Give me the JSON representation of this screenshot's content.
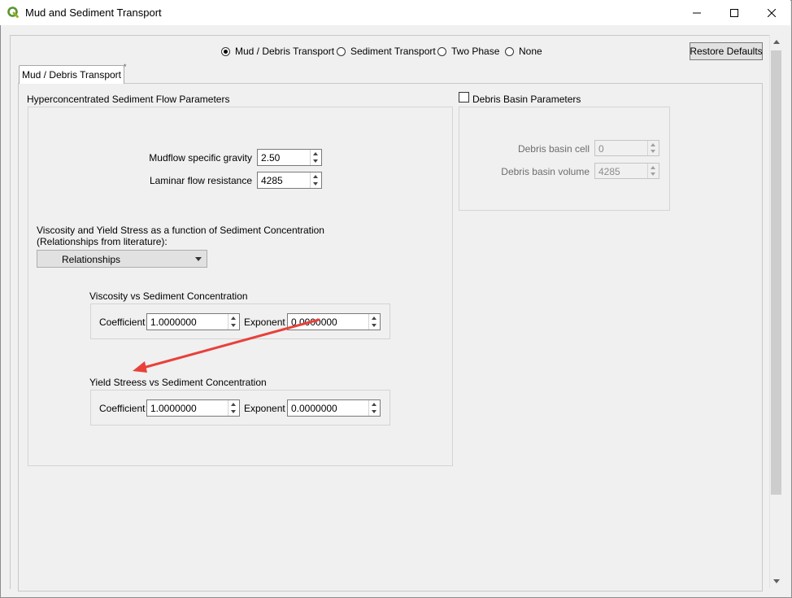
{
  "window": {
    "title": "Mud and Sediment Transport"
  },
  "transport_mode": {
    "options": [
      {
        "label": "Mud / Debris Transport",
        "selected": true
      },
      {
        "label": "Sediment Transport",
        "selected": false
      },
      {
        "label": "Two Phase",
        "selected": false
      },
      {
        "label": "None",
        "selected": false
      }
    ]
  },
  "restore_defaults_label": "Restore Defaults",
  "tab": {
    "label": "Mud / Debris Transport",
    "modified_marker": "*"
  },
  "hyper": {
    "title": "Hyperconcentrated Sediment Flow Parameters",
    "specific_gravity": {
      "label": "Mudflow specific gravity",
      "value": "2.50"
    },
    "laminar_resistance": {
      "label": "Laminar flow resistance",
      "value": "4285"
    },
    "relationships_text_1": "Viscosity and Yield Stress as a function of Sediment Concentration",
    "relationships_text_2": "(Relationships from literature):",
    "relationships_combo": "Relationships",
    "viscosity": {
      "title": "Viscosity vs Sediment Concentration",
      "coefficient_label": "Coefficient",
      "coefficient": "1.0000000",
      "exponent_label": "Exponent",
      "exponent": "0.0000000"
    },
    "yield": {
      "title": "Yield Streess vs Sediment Concentration",
      "coefficient_label": "Coefficient",
      "coefficient": "1.0000000",
      "exponent_label": "Exponent",
      "exponent": "0.0000000"
    }
  },
  "debris": {
    "title": "Debris Basin Parameters",
    "checked": false,
    "cell": {
      "label": "Debris basin cell",
      "value": "0"
    },
    "volume": {
      "label": "Debris basin volume",
      "value": "4285"
    }
  },
  "colors": {
    "annotation_arrow": "#e8413a",
    "accent": "#e1e1e1"
  }
}
